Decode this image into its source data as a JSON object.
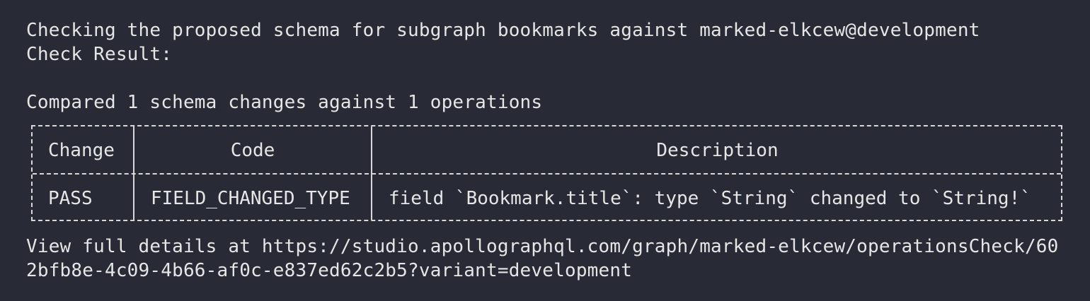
{
  "terminal": {
    "lines": {
      "check_header": "Checking the proposed schema for subgraph bookmarks against marked-elkcew@development",
      "check_result": "Check Result:",
      "compared": "Compared 1 schema changes against 1 operations",
      "details_1": "View full details at https://studio.apollographql.com/graph/marked-elkcew/operationsCheck/60",
      "details_2": "2bfb8e-4c09-4b66-af0c-e837ed62c2b5?variant=development"
    },
    "table": {
      "headers": [
        "Change",
        "Code",
        "Description"
      ],
      "rows": [
        [
          "PASS",
          "FIELD_CHANGED_TYPE",
          "field `Bookmark.title`: type `String` changed to `String!`"
        ]
      ]
    },
    "colors": {
      "background": "#282a35",
      "text": "#e6e6e6",
      "border": "#d8d8d8"
    }
  }
}
